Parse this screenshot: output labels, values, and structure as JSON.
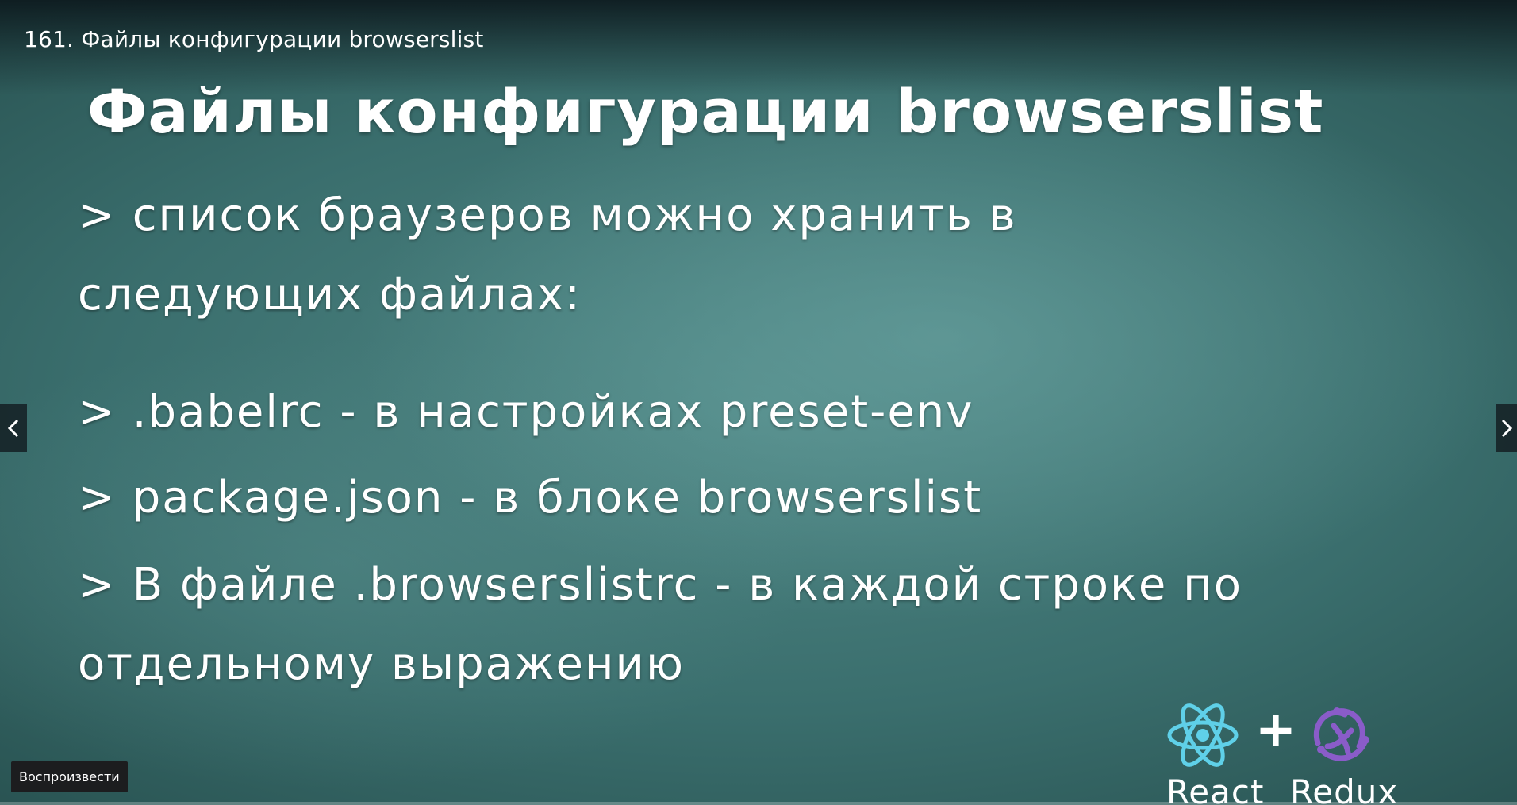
{
  "player": {
    "video_title": "161. Файлы конфигурации browserslist",
    "play_tooltip": "Воспроизвести",
    "progress_fraction": 0
  },
  "slide": {
    "heading": "Файлы конфигурации browserslist",
    "bullets": [
      {
        "line1": "> список браузеров можно хранить в",
        "line2": "следующих файлах:"
      },
      {
        "line1": "> .babelrc - в настройках preset-env"
      },
      {
        "line1": "> package.json - в блоке browserslist"
      },
      {
        "line1": "> В файле .browserslistrc - в каждой строке по",
        "line2": "отдельному выражению"
      }
    ],
    "logos": {
      "left_label": "React",
      "plus": "+",
      "right_label": "Redux"
    }
  },
  "icons": {
    "prev": "chevron-left-icon",
    "next": "chevron-right-icon",
    "react": "react-atom-icon",
    "redux": "redux-logo-icon"
  },
  "colors": {
    "background": "#3a6e6d",
    "text": "#ffffff",
    "react_logo": "#5fd0e8",
    "redux_logo": "#8a5cc9"
  }
}
